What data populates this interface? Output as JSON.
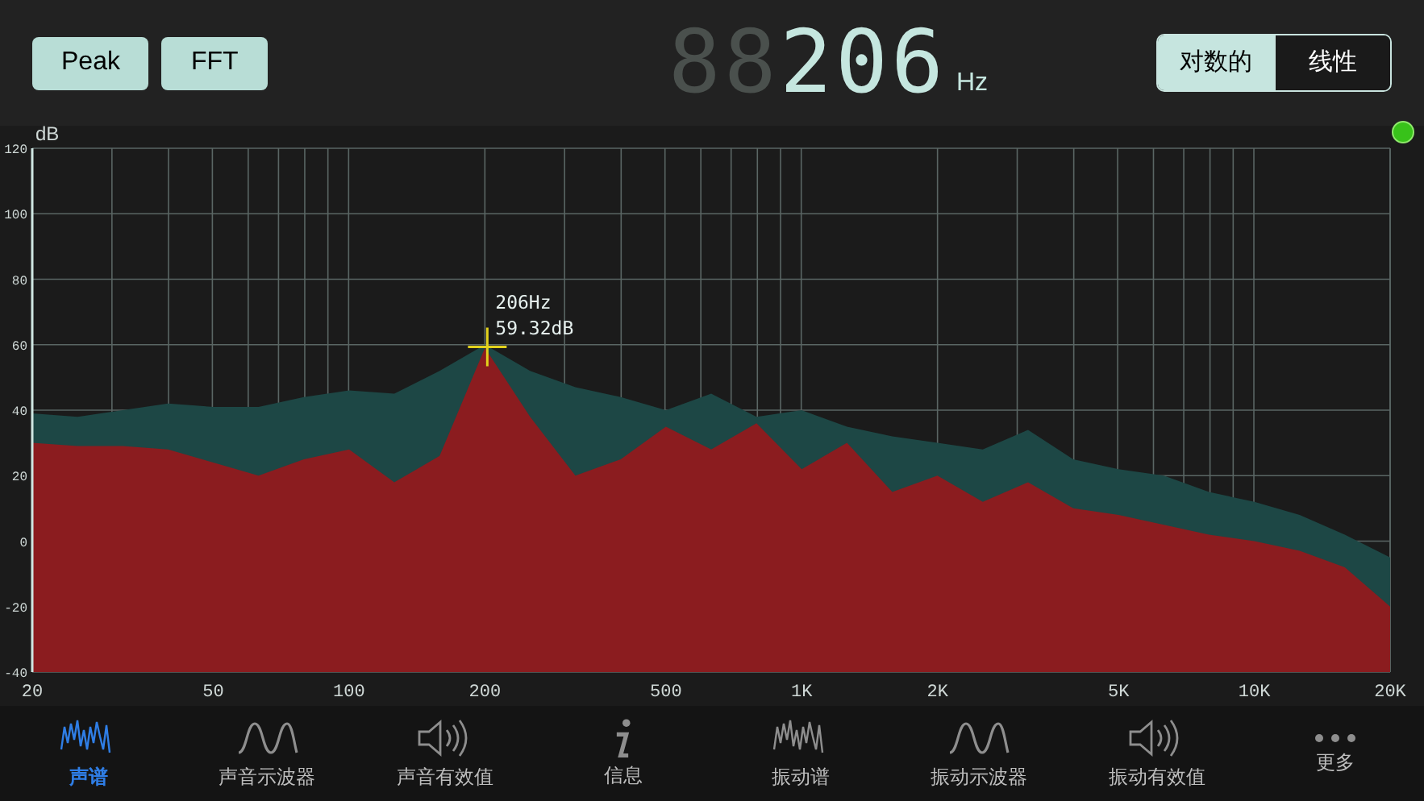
{
  "toolbar": {
    "buttons": [
      {
        "label": "Peak"
      },
      {
        "label": "FFT"
      }
    ],
    "display": {
      "ghost_digits": "88",
      "value": "206",
      "unit": "Hz"
    },
    "scale_toggle": [
      {
        "label": "对数的",
        "selected": true
      },
      {
        "label": "线性",
        "selected": false
      }
    ]
  },
  "indicator": {
    "on": true
  },
  "chart_data": {
    "type": "area",
    "grid": true,
    "ylabel": "dB",
    "ylim": [
      -40,
      120
    ],
    "yticks": [
      120,
      100,
      80,
      60,
      40,
      20,
      0,
      -20,
      -40
    ],
    "categories": [
      "20",
      null,
      null,
      null,
      "50",
      null,
      null,
      "100",
      null,
      null,
      "200",
      null,
      null,
      null,
      "500",
      null,
      null,
      "1K",
      null,
      null,
      "2K",
      null,
      null,
      null,
      "5K",
      null,
      null,
      "10K",
      null,
      null,
      "20K"
    ],
    "series": [
      {
        "color": "#1d4745",
        "values": [
          39,
          38,
          40,
          42,
          41,
          41,
          44,
          46,
          45,
          52,
          60,
          52,
          47,
          44,
          40,
          45,
          38,
          40,
          35,
          32,
          30,
          28,
          34,
          25,
          22,
          20,
          15,
          12,
          8,
          2,
          -5
        ]
      },
      {
        "color": "#8b1c1f",
        "values": [
          30,
          29,
          29,
          28,
          24,
          20,
          25,
          28,
          18,
          26,
          59,
          38,
          20,
          25,
          35,
          28,
          36,
          22,
          30,
          15,
          20,
          12,
          18,
          10,
          8,
          5,
          2,
          0,
          -3,
          -8,
          -20
        ]
      }
    ],
    "annotations": [
      {
        "x": "200",
        "y": 59.32,
        "text": "206Hz"
      },
      {
        "x": "200",
        "y": 59.32,
        "text": "59.32dB"
      }
    ]
  },
  "tabs": [
    {
      "label": "声谱",
      "kind": "spectrum",
      "selected": true
    },
    {
      "label": "声音示波器",
      "kind": "wave",
      "selected": false
    },
    {
      "label": "声音有效值",
      "kind": "speaker",
      "selected": false
    },
    {
      "label": "信息",
      "kind": "info",
      "selected": false
    },
    {
      "label": "振动谱",
      "kind": "spectrum",
      "selected": false
    },
    {
      "label": "振动示波器",
      "kind": "wave",
      "selected": false
    },
    {
      "label": "振动有效值",
      "kind": "speaker",
      "selected": false
    },
    {
      "label": "更多",
      "kind": "more",
      "selected": false
    }
  ]
}
